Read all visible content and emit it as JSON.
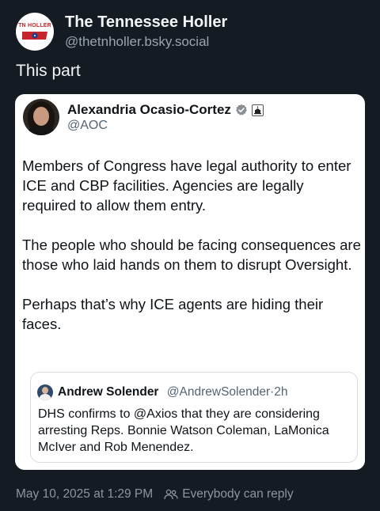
{
  "post": {
    "author": {
      "display_name": "The Tennessee Holler",
      "handle": "@thetnholler.bsky.social",
      "avatar_logo_text": "TN HOLLER"
    },
    "text": "This part",
    "timestamp": "May 10, 2025 at 1:29 PM",
    "reply_setting": "Everybody can reply"
  },
  "quoted": {
    "author": {
      "display_name": "Alexandria Ocasio-Cortez",
      "handle": "@AOC"
    },
    "paragraphs": [
      "Members of Congress have legal authority to enter ICE and CBP facilities. Agencies are legally required to allow them entry.",
      "The people who should be facing consequences are those who laid hands on them to disrupt Oversight.",
      "Perhaps that’s why ICE agents are hiding their faces."
    ],
    "inner_quote": {
      "display_name": "Andrew Solender",
      "handle": "@AndrewSolender",
      "separator": "·",
      "time": "2h",
      "text": "DHS confirms to @Axios that they are considering arresting Reps. Bonnie Watson Coleman, LaMonica McIver and Rob Menendez."
    }
  },
  "colors": {
    "background": "#151b22",
    "card": "#ffffff",
    "verified_badge": "#8a8f96",
    "muted_text": "#8b96a2"
  },
  "icons": {
    "verified": "verified-badge-icon",
    "affiliation": "capitol-icon",
    "reply": "people-icon"
  }
}
